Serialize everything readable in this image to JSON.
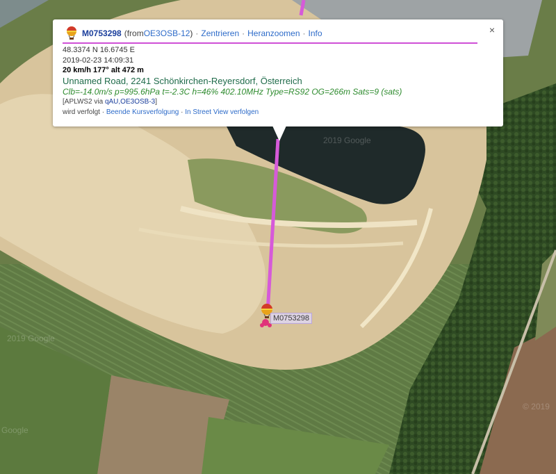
{
  "popup": {
    "callsign": "M0753298",
    "from_prefix": "(from ",
    "from_station": "OE3OSB-12",
    "from_suffix": ")",
    "links": [
      "Zentrieren",
      "Heranzoomen",
      "Info"
    ],
    "close_label": "×",
    "coordinates": "48.3374 N 16.6745 E",
    "timestamp": "2019-02-23 14:09:31",
    "speed_course_alt": "20 km/h 177° alt 472 m",
    "address": "Unnamed Road, 2241 Schönkirchen-Reyersdorf, Österreich",
    "telemetry": "Clb=-14.0m/s p=995.6hPa t=-2.3C h=46% 402.10MHz Type=RS92 OG=266m Sats=9 (sats)",
    "path_prefix": "[APLWS2 via ",
    "path_link": "qAU,OE3OSB-3",
    "path_suffix": "]",
    "tracking_text": "wird verfolgt",
    "tracking_links": [
      "Beende Kursverfolgung",
      "In Street View verfolgen"
    ]
  },
  "marker": {
    "label": "M0753298"
  },
  "watermarks": [
    "2019 Google",
    "2019 Google",
    "© 2019",
    "Google"
  ],
  "colors": {
    "track": "#d65ad9",
    "accent": "#1a3e9c",
    "link": "#2d6bc9"
  }
}
